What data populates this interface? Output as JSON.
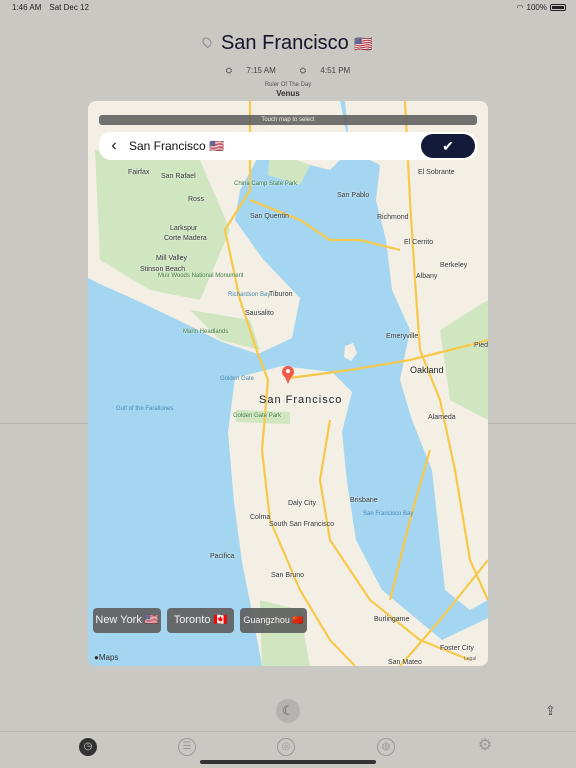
{
  "status": {
    "time": "1:46 AM",
    "date": "Sat Dec 12",
    "battery": "100%",
    "battery_level": 1.0
  },
  "header": {
    "city": "San Francisco",
    "flag": "🇺🇸",
    "sunrise": "7:15 AM",
    "sunset": "4:51 PM",
    "ruler_label": "Ruler Of The Day",
    "ruler": "Venus"
  },
  "map": {
    "hint": "Touch map to select",
    "selected": "San Francisco 🇺🇸",
    "confirm_icon": "checkmark-icon",
    "attribution": "Maps",
    "legal": "Legal",
    "places": [
      "San Francisco",
      "Oakland",
      "San Rafael",
      "Richmond",
      "Berkeley",
      "Daly City",
      "South San Francisco",
      "San Bruno",
      "Burlingame",
      "Pacifica",
      "Sausalito",
      "Tiburon",
      "Mill Valley",
      "Larkspur",
      "Corte Madera",
      "Ross",
      "Fairfax",
      "San Quentin",
      "San Pablo",
      "El Sobrante",
      "El Cerrito",
      "Albany",
      "Emeryville",
      "Alameda",
      "Brisbane",
      "Colma",
      "Stinson Beach",
      "Foster City",
      "San Mateo",
      "Piedmont"
    ],
    "parks": [
      "Muir Woods National Monument",
      "Marin Headlands",
      "Golden Gate Park",
      "China Camp State Park"
    ],
    "water": [
      "Gulf of the Farallones",
      "Golden Gate",
      "San Francisco Bay",
      "Richardson Bay"
    ],
    "colors": {
      "water": "#a4d6f2",
      "land": "#f3efe4",
      "park": "#cfe6c0",
      "road": "#f7c94a",
      "pin": "#f05a4a"
    }
  },
  "quick_cities": [
    {
      "label": "New York 🇺🇸"
    },
    {
      "label": "Toronto 🇨🇦"
    },
    {
      "label": "Guangzhou 🇨🇳"
    }
  ],
  "controls": {
    "moon_icon": "moon-icon",
    "share_icon": "share-icon"
  },
  "tabs": [
    {
      "icon": "clock-icon",
      "active": true
    },
    {
      "icon": "list-icon"
    },
    {
      "icon": "search-icon"
    },
    {
      "icon": "globe-icon"
    },
    {
      "icon": "gear-icon"
    }
  ]
}
